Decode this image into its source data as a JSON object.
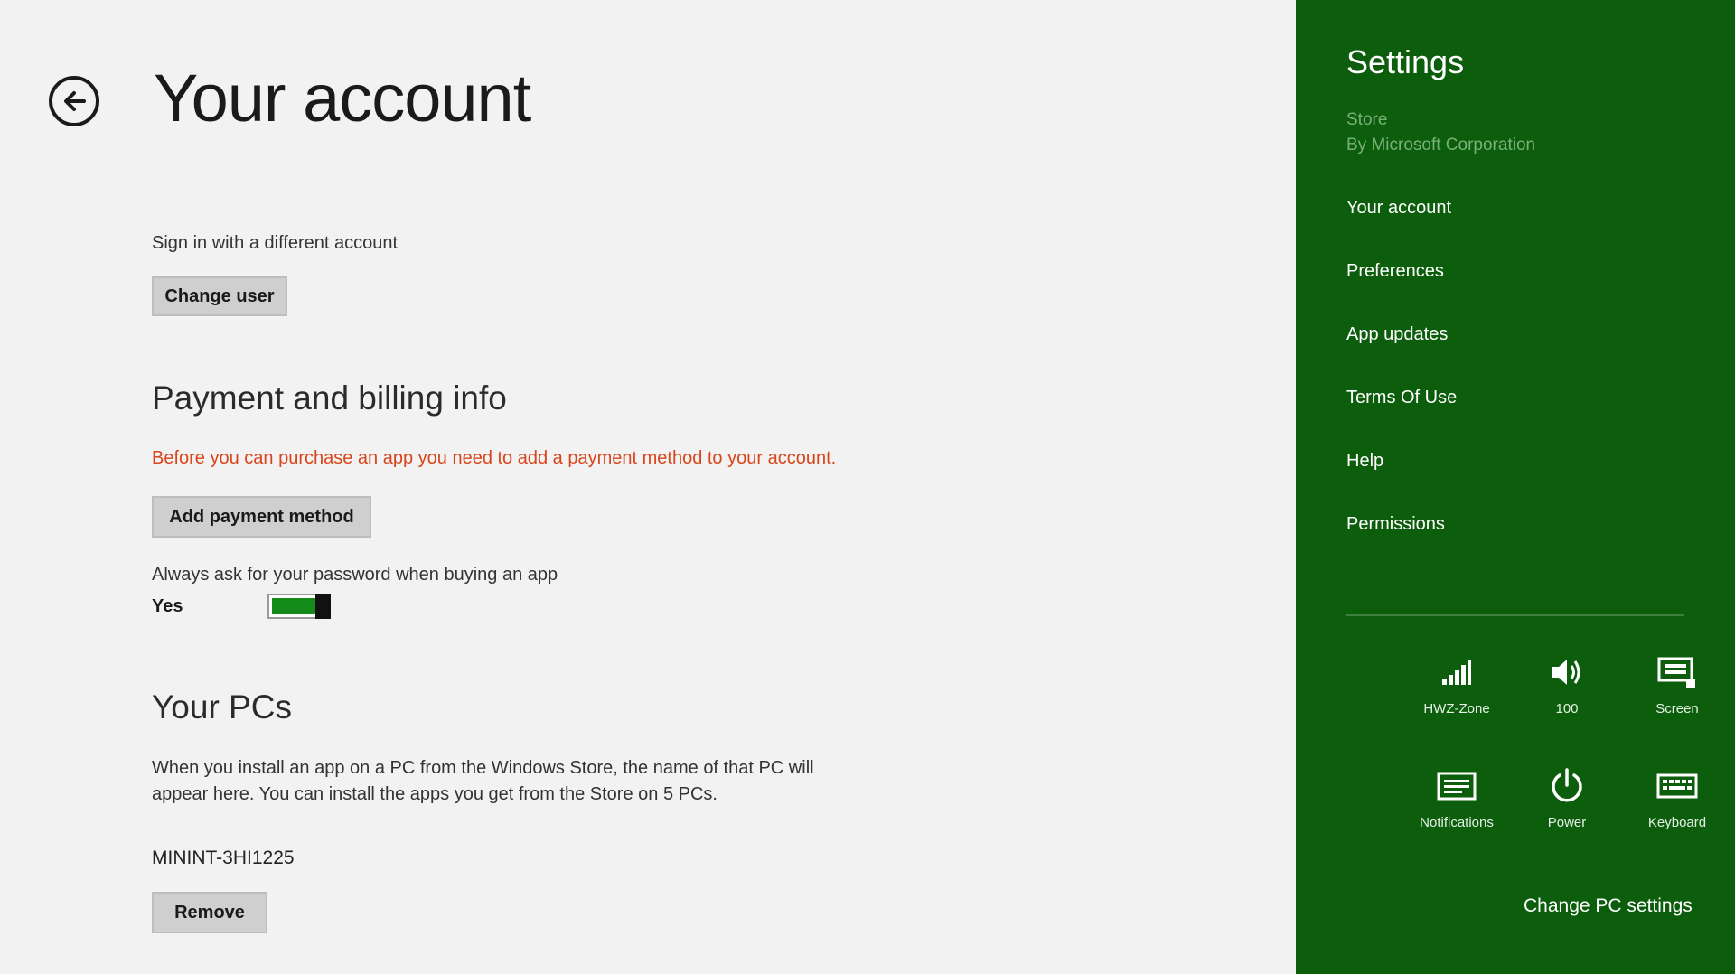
{
  "main": {
    "title": "Your account",
    "signin_label": "Sign in with a different account",
    "change_user_button": "Change user",
    "payment_heading": "Payment and billing info",
    "payment_warning": "Before you can purchase an app you need to add a payment method to your account.",
    "add_payment_button": "Add payment method",
    "password_label": "Always ask for your password when buying an app",
    "password_toggle_value": "Yes",
    "password_toggle_on": true,
    "pcs_heading": "Your PCs",
    "pcs_description": "When you install an app on a PC from the Windows Store, the name of that PC will appear here. You can install the apps you get from the Store on 5 PCs.",
    "pc_name": "MININT-3HI1225",
    "remove_button": "Remove"
  },
  "settings_charm": {
    "title": "Settings",
    "app_name": "Store",
    "app_publisher": "By Microsoft Corporation",
    "menu_items": [
      "Your account",
      "Preferences",
      "App updates",
      "Terms Of Use",
      "Help",
      "Permissions"
    ],
    "quick_settings": [
      {
        "label": "HWZ-Zone",
        "icon": "network-signal-icon"
      },
      {
        "label": "100",
        "icon": "volume-icon"
      },
      {
        "label": "Screen",
        "icon": "screen-brightness-icon"
      },
      {
        "label": "Notifications",
        "icon": "notifications-icon"
      },
      {
        "label": "Power",
        "icon": "power-icon"
      },
      {
        "label": "Keyboard",
        "icon": "keyboard-icon"
      }
    ],
    "change_pc_settings": "Change PC settings"
  },
  "colors": {
    "charm_background": "#0c5d0c",
    "accent_warning": "#d9451a",
    "toggle_on": "#138a1a",
    "page_background": "#f2f2f2"
  }
}
